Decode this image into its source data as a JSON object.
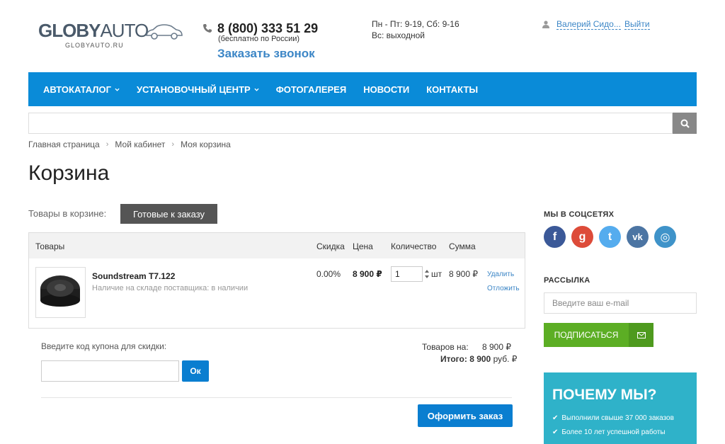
{
  "header": {
    "logo_bold": "GLOBY",
    "logo_light": "AUTO",
    "logo_sub": "GLOBYAUTO.RU",
    "phone": "8 (800) 333 51 29",
    "phone_note": "(бесплатно по России)",
    "callback": "Заказать звонок",
    "hours_weekdays": "Пн - Пт: 9-19, Сб: 9-16",
    "hours_sunday": "Вс: выходной",
    "user_name": "Валерий Сидо...",
    "logout": "Выйти"
  },
  "nav": {
    "items": [
      {
        "label": "АВТОКАТАЛОГ",
        "dropdown": true
      },
      {
        "label": "УСТАНОВОЧНЫЙ ЦЕНТР",
        "dropdown": true
      },
      {
        "label": "ФОТОГАЛЕРЕЯ",
        "dropdown": false
      },
      {
        "label": "НОВОСТИ",
        "dropdown": false
      },
      {
        "label": "КОНТАКТЫ",
        "dropdown": false
      }
    ]
  },
  "search": {
    "placeholder": ""
  },
  "breadcrumb": [
    "Главная страница",
    "Мой кабинет",
    "Моя корзина"
  ],
  "page_title": "Корзина",
  "cart": {
    "label": "Товары в корзине:",
    "tab_ready": "Готовые к заказу",
    "columns": {
      "goods": "Товары",
      "discount": "Скидка",
      "price": "Цена",
      "qty": "Количество",
      "sum": "Сумма"
    },
    "items": [
      {
        "name": "Soundstream T7.122",
        "stock": "Наличие на складе поставщика: в наличии",
        "discount": "0.00%",
        "price": "8 900 ₽",
        "qty": "1",
        "unit": "шт",
        "sum": "8 900 ₽",
        "delete": "Удалить",
        "defer": "Отложить"
      }
    ],
    "coupon_label": "Введите код купона для скидки:",
    "coupon_btn": "Ок",
    "totals_label": "Товаров на:",
    "totals_value": "8 900 ₽",
    "total_label": "Итого:",
    "total_value": "8 900",
    "total_currency": "руб. ₽",
    "checkout": "Оформить заказ"
  },
  "sidebar": {
    "social_title": "МЫ В СОЦСЕТЯХ",
    "social": [
      {
        "name": "facebook",
        "glyph": "f",
        "color": "#3b5998"
      },
      {
        "name": "google-plus",
        "glyph": "g",
        "color": "#dd4b39"
      },
      {
        "name": "twitter",
        "glyph": "t",
        "color": "#55acee"
      },
      {
        "name": "vk",
        "glyph": "vk",
        "color": "#4c75a3"
      },
      {
        "name": "instagram",
        "glyph": "◎",
        "color": "#3f93c9"
      }
    ],
    "newsletter_title": "РАССЫЛКА",
    "email_placeholder": "Введите ваш e-mail",
    "subscribe": "ПОДПИСАТЬСЯ",
    "why_title": "ПОЧЕМУ МЫ?",
    "why_items": [
      "Выполнили свыше 37 000 заказов",
      "Более 10 лет успешной работы"
    ]
  },
  "colors": {
    "nav_bg": "#0a8bd8",
    "link": "#3c86c6",
    "accent_btn": "#0a7ed0",
    "subscribe": "#5cae24",
    "why_bg": "#2fb2c9"
  }
}
